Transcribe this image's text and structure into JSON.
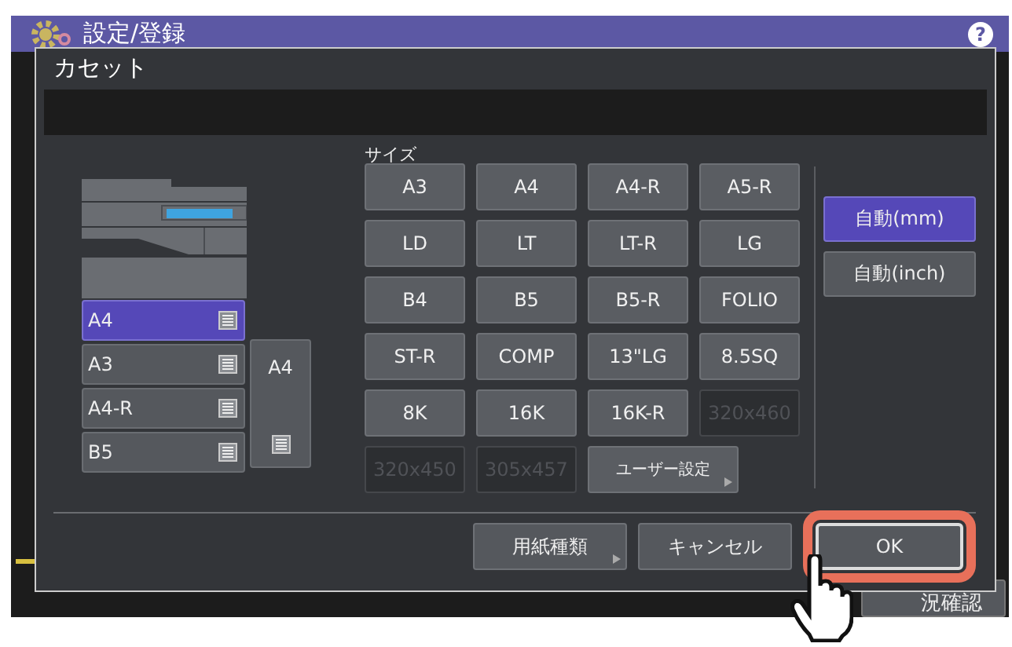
{
  "header": {
    "title": "設定/登録",
    "help": "?"
  },
  "background_button": {
    "label": "況確認"
  },
  "dialog": {
    "title": "カセット",
    "cassettes": [
      {
        "label": "A4",
        "selected": true
      },
      {
        "label": "A3",
        "selected": false
      },
      {
        "label": "A4-R",
        "selected": false
      },
      {
        "label": "B5",
        "selected": false
      }
    ],
    "bypass": {
      "label": "A4"
    },
    "size_label": "サイズ",
    "sizes": [
      {
        "label": "A3",
        "disabled": false
      },
      {
        "label": "A4",
        "disabled": false
      },
      {
        "label": "A4-R",
        "disabled": false
      },
      {
        "label": "A5-R",
        "disabled": false
      },
      {
        "label": "LD",
        "disabled": false
      },
      {
        "label": "LT",
        "disabled": false
      },
      {
        "label": "LT-R",
        "disabled": false
      },
      {
        "label": "LG",
        "disabled": false
      },
      {
        "label": "B4",
        "disabled": false
      },
      {
        "label": "B5",
        "disabled": false
      },
      {
        "label": "B5-R",
        "disabled": false
      },
      {
        "label": "FOLIO",
        "disabled": false
      },
      {
        "label": "ST-R",
        "disabled": false
      },
      {
        "label": "COMP",
        "disabled": false
      },
      {
        "label": "13\"LG",
        "disabled": false
      },
      {
        "label": "8.5SQ",
        "disabled": false
      },
      {
        "label": "8K",
        "disabled": false
      },
      {
        "label": "16K",
        "disabled": false
      },
      {
        "label": "16K-R",
        "disabled": false
      },
      {
        "label": "320x460",
        "disabled": true
      },
      {
        "label": "320x450",
        "disabled": true
      },
      {
        "label": "305x457",
        "disabled": true
      }
    ],
    "user_setting": {
      "label": "ユーザー設定",
      "submenu": true
    },
    "auto": [
      {
        "label": "自動(mm)",
        "selected": true
      },
      {
        "label": "自動(inch)",
        "selected": false
      }
    ],
    "footer": [
      {
        "label": "用紙種類",
        "submenu": true,
        "highlighted": false
      },
      {
        "label": "キャンセル",
        "submenu": false,
        "highlighted": false
      },
      {
        "label": "OK",
        "submenu": false,
        "highlighted": true
      }
    ]
  }
}
